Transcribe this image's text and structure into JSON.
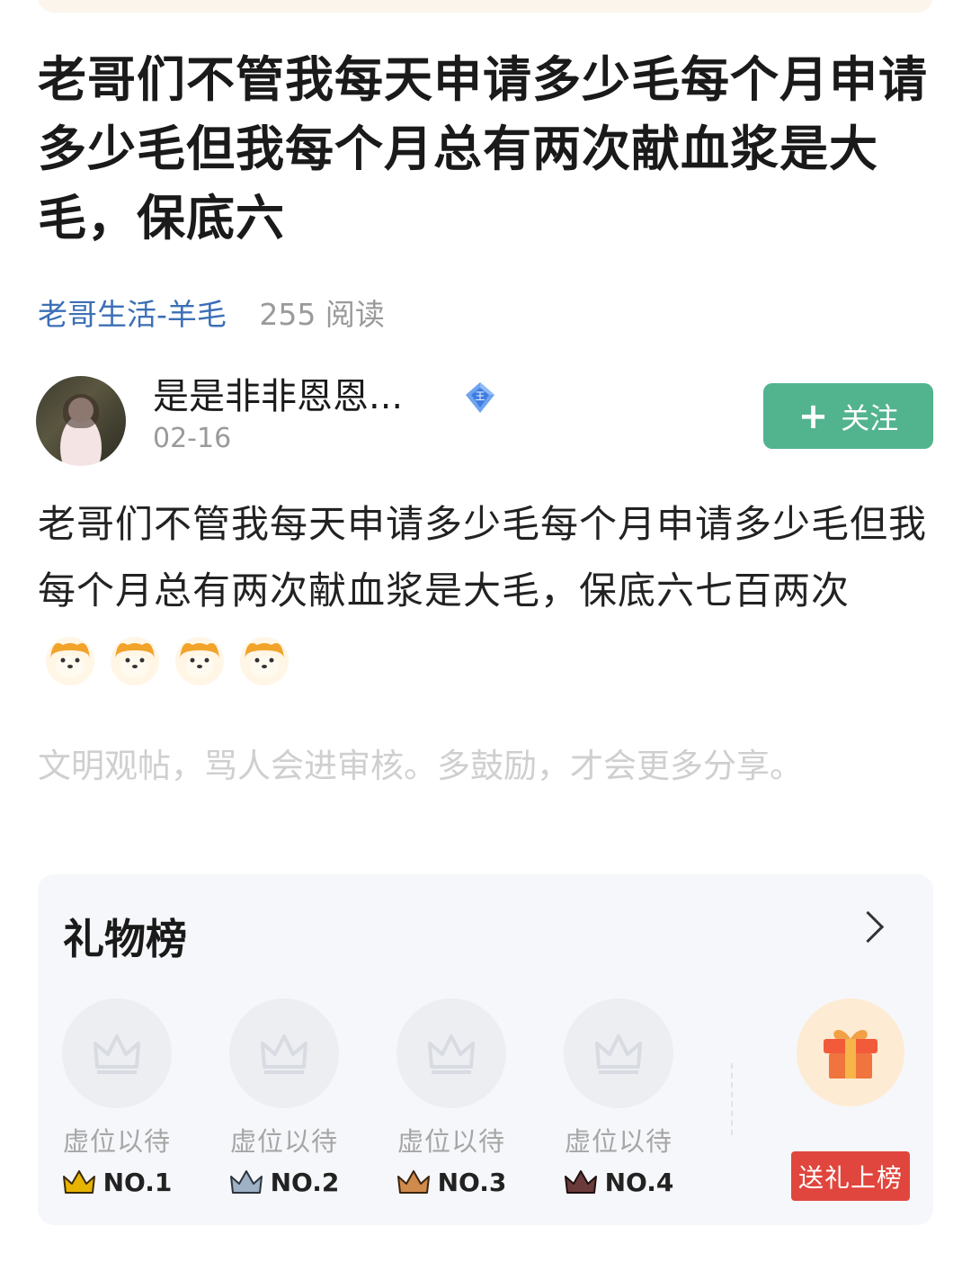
{
  "post": {
    "title": "老哥们不管我每天申请多少毛每个月申请多少毛但我每个月总有两次献血浆是大毛，保底六",
    "channel": "老哥生活-羊毛",
    "reads": "255 阅读",
    "body": "老哥们不管我每天申请多少毛每个月申请多少毛但我每个月总有两次献血浆是大毛，保底六七百两次",
    "emojis": [
      "shiba-emoji",
      "shiba-emoji",
      "shiba-emoji",
      "shiba-emoji"
    ],
    "civility_note": "文明观帖，骂人会进审核。多鼓励，才会更多分享。"
  },
  "author": {
    "name": "是是非非恩恩...",
    "date": "02-16",
    "badge_icon": "diamond-badge-icon",
    "follow_label": "关注"
  },
  "gift_board": {
    "title": "礼物榜",
    "slots": [
      {
        "label": "虚位以待",
        "rank": "NO.1",
        "crown_color": "#e7b400"
      },
      {
        "label": "虚位以待",
        "rank": "NO.2",
        "crown_color": "#9fb1c4"
      },
      {
        "label": "虚位以待",
        "rank": "NO.3",
        "crown_color": "#d08a4c"
      },
      {
        "label": "虚位以待",
        "rank": "NO.4",
        "crown_color": "#6b3b3b"
      }
    ],
    "send_button": "送礼上榜"
  },
  "colors": {
    "accent_green": "#52b38f",
    "link_blue": "#3c6fb6",
    "gift_red": "#e0463d"
  }
}
